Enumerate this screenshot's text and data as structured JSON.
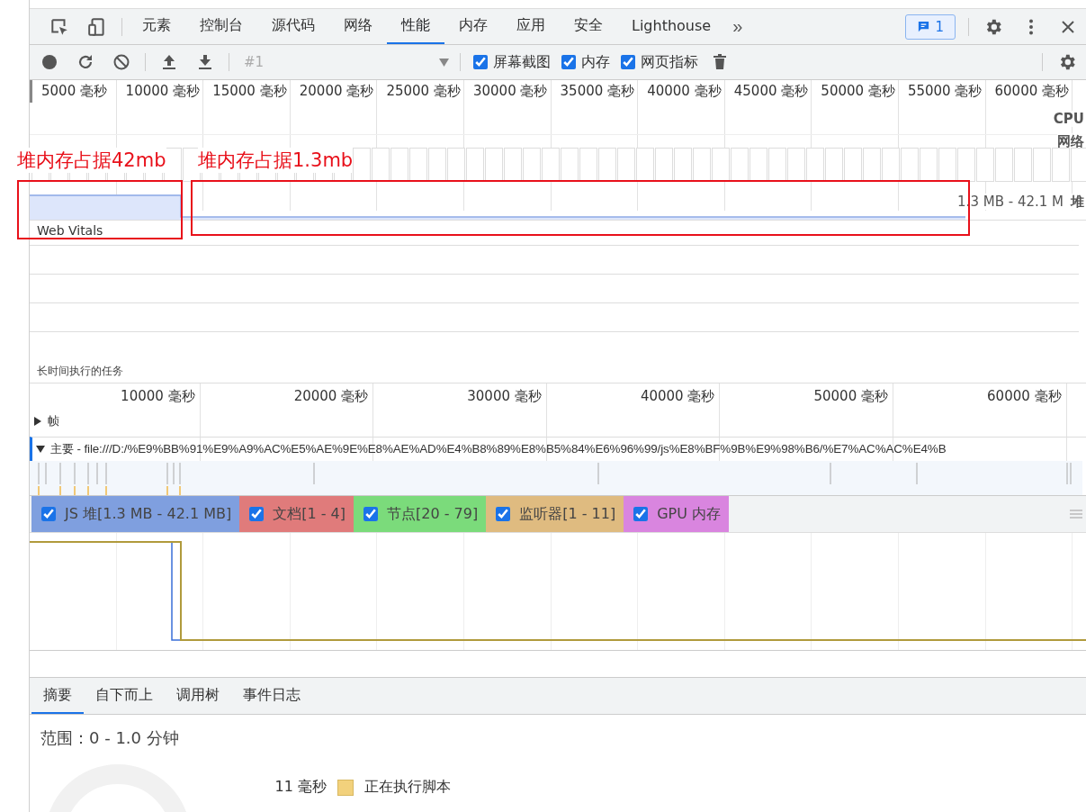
{
  "main_tabs": {
    "tabs": [
      {
        "label": "元素",
        "selected": false
      },
      {
        "label": "控制台",
        "selected": false
      },
      {
        "label": "源代码",
        "selected": false
      },
      {
        "label": "网络",
        "selected": false
      },
      {
        "label": "性能",
        "selected": true
      },
      {
        "label": "内存",
        "selected": false
      },
      {
        "label": "应用",
        "selected": false
      },
      {
        "label": "安全",
        "selected": false
      },
      {
        "label": "Lighthouse",
        "selected": false
      }
    ],
    "overflow": "»",
    "messages": "1"
  },
  "toolbar": {
    "recording": "#1",
    "options": [
      {
        "label": "屏幕截图",
        "checked": true
      },
      {
        "label": "内存",
        "checked": true
      },
      {
        "label": "网页指标",
        "checked": true
      }
    ]
  },
  "overview": {
    "ticks": [
      "5000 毫秒",
      "10000 毫秒",
      "15000 毫秒",
      "20000 毫秒",
      "25000 毫秒",
      "30000 毫秒",
      "35000 毫秒",
      "40000 毫秒",
      "45000 毫秒",
      "50000 毫秒",
      "55000 毫秒",
      "60000 毫秒"
    ],
    "track_labels": [
      "CPU",
      "网络",
      "堆"
    ],
    "heap_range": "1.3 MB - 42.1 M"
  },
  "annotations": [
    {
      "text": "堆内存占据42mb"
    },
    {
      "text": "堆内存占据1.3mb"
    }
  ],
  "web_vitals": {
    "title": "Web Vitals",
    "long_tasks": "长时间执行的任务"
  },
  "timeline": {
    "ticks": [
      "10000 毫秒",
      "20000 毫秒",
      "30000 毫秒",
      "40000 毫秒",
      "50000 毫秒",
      "60000 毫秒"
    ],
    "tracks": [
      {
        "label": "帧",
        "expanded": false
      },
      {
        "label": "主要 - file:///D:/%E9%BB%91%E9%A9%AC%E5%AE%9E%E8%AE%AD%E4%B8%89%E8%B5%84%E6%96%99/js%E8%BF%9B%E9%98%B6/%E7%AC%AC%E4%B",
        "expanded": true
      }
    ]
  },
  "counters": [
    {
      "label": "JS 堆[1.3 MB - 42.1 MB]",
      "checked": true,
      "color": "#7f9fdf"
    },
    {
      "label": "文档[1 - 4]",
      "checked": true,
      "color": "#e07b7b"
    },
    {
      "label": "节点[20 - 79]",
      "checked": true,
      "color": "#7bdb7b"
    },
    {
      "label": "监听器[1 - 11]",
      "checked": true,
      "color": "#dfbb80"
    },
    {
      "label": "GPU 内存",
      "checked": true,
      "color": "#d985df"
    }
  ],
  "bottom_tabs": [
    {
      "label": "摘要",
      "selected": true
    },
    {
      "label": "自下而上",
      "selected": false
    },
    {
      "label": "调用树",
      "selected": false
    },
    {
      "label": "事件日志",
      "selected": false
    }
  ],
  "summary": {
    "range": "范围：0 - 1.0 分钟",
    "rows": [
      {
        "time": "11 毫秒",
        "label": "正在执行脚本",
        "color": "#f2d17c"
      }
    ]
  }
}
